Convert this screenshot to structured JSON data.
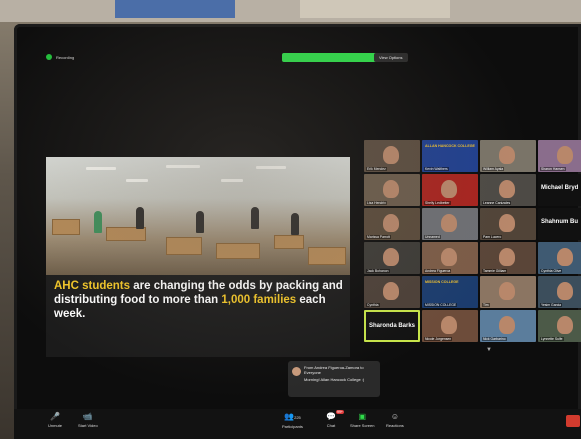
{
  "top_bar": {
    "recording_label": "Recording",
    "view_options_label": "View Options"
  },
  "shared_screen": {
    "caption": {
      "part1": "AHC students",
      "part2": " are changing the odds by packing and distributing food to more than ",
      "part3": "1,000 families",
      "part4": " each week."
    }
  },
  "participants": [
    {
      "name": "Erik Mendez"
    },
    {
      "name": "Kevin Walthers",
      "tile_text": "ALLAN HANCOCK COLLEGE"
    },
    {
      "name": "William Ayala"
    },
    {
      "name": "Sharon Hansen"
    },
    {
      "name": "Lisa Hendrix"
    },
    {
      "name": "Shelly Ledbetter"
    },
    {
      "name": "Leanne Canizales"
    },
    {
      "name": "Michael Bryd",
      "text_only": true
    },
    {
      "name": "Marissa Parrott"
    },
    {
      "name": "Unnamed"
    },
    {
      "name": "Pam Lucero"
    },
    {
      "name": "Shahnum Bu",
      "text_only": true
    },
    {
      "name": "Jack Bohanon"
    },
    {
      "name": "Andrea Figueroa"
    },
    {
      "name": "Tammie Gilliam"
    },
    {
      "name": "Cynthia Olive"
    },
    {
      "name": "Cynthia"
    },
    {
      "name": "MISSION COLLEGE",
      "tile_text": "MISSION COLLEGE"
    },
    {
      "name": "Tim"
    },
    {
      "name": "Yesim Garcia"
    },
    {
      "name": "Sharonda Barks",
      "speaker": true
    },
    {
      "name": "Nicole Jorgensen"
    },
    {
      "name": "Nick Garbarino"
    },
    {
      "name": "Lynnette Sulfe"
    }
  ],
  "chat_popup": {
    "from": "From Andrea Figueroa-Zamora to Everyone",
    "message": "Morning! Allan Hancock College :)"
  },
  "toolbar": {
    "unmute": "Unmute",
    "start_video": "Start Video",
    "participants": "Participants",
    "participants_count": "225",
    "chat": "Chat",
    "chat_badge": "99+",
    "share_screen": "Share Screen",
    "reactions": "Reactions"
  },
  "colors": {
    "caption_highlight": "#f6c928",
    "active_speaker_border": "#c8e64a",
    "share_green": "#2fdc4a"
  }
}
